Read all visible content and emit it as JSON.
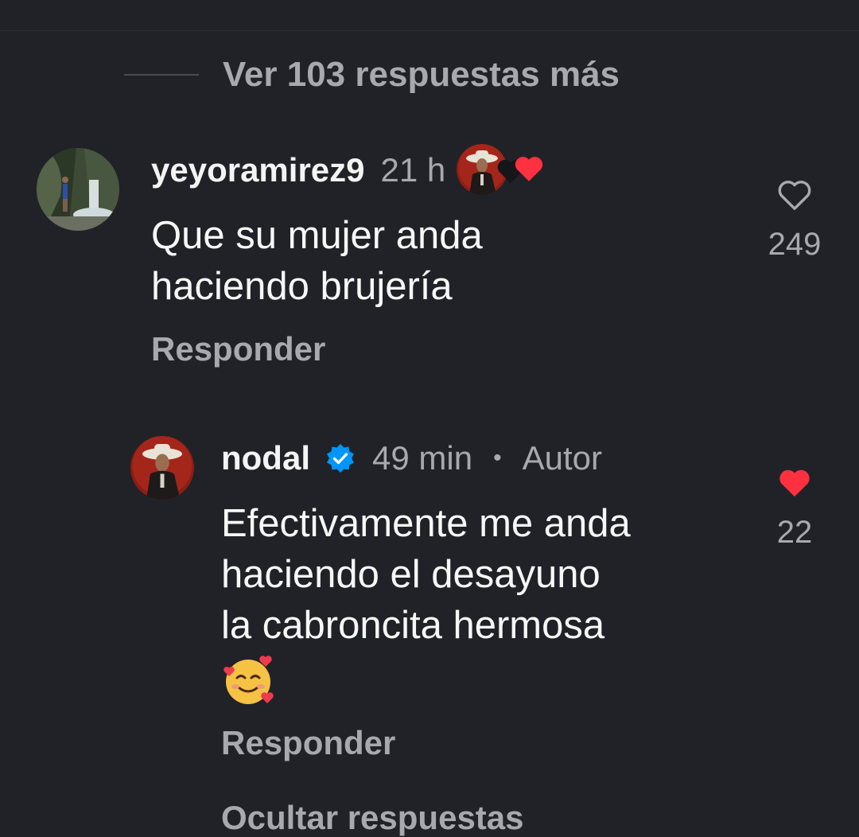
{
  "thread": {
    "view_more_label": "Ver 103 respuestas más",
    "hide_replies_label": "Ocultar respuestas"
  },
  "comment": {
    "username": "yeyoramirez9",
    "time": "21 h",
    "text_line1": "Que su mujer anda",
    "text_line2": "haciendo brujería",
    "reply_label": "Responder",
    "like_count": "249",
    "liked": false
  },
  "reply": {
    "username": "nodal",
    "verified": true,
    "time": "49 min",
    "separator": "•",
    "author_label": "Autor",
    "text_line1": "Efectivamente me anda",
    "text_line2": "haciendo el desayuno",
    "text_line3": "la cabroncita hermosa",
    "emoji": "🥰",
    "reply_label": "Responder",
    "like_count": "22",
    "liked": true
  },
  "colors": {
    "background": "#212227",
    "muted_text": "#a8a9ae",
    "like_red": "#ff3040",
    "verified_blue": "#0095f6"
  }
}
